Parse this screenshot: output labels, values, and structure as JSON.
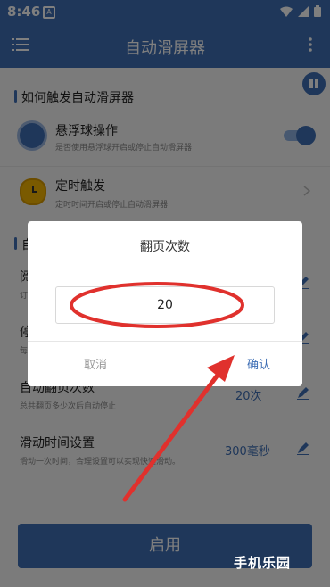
{
  "status_bar": {
    "time": "8:46",
    "sim_label": "A"
  },
  "app_bar": {
    "title": "自动滑屏器"
  },
  "sections": {
    "trigger": {
      "title": "如何触发自动滑屏器",
      "items": [
        {
          "title": "悬浮球操作",
          "subtitle": "是否使用悬浮球开启或停止自动滑屏器",
          "toggle_on": true
        },
        {
          "title": "定时触发",
          "subtitle": "定时时间开启或停止自动滑屏器"
        }
      ]
    },
    "settings": {
      "title_partial": "自",
      "rows": [
        {
          "title": "阅",
          "subtitle": "订"
        },
        {
          "title": "停",
          "subtitle": "每"
        },
        {
          "title": "自动翻页次数",
          "subtitle": "总共翻页多少次后自动停止",
          "value": "20次"
        },
        {
          "title": "滑动时间设置",
          "subtitle": "滑动一次时间，合理设置可以实现快速滑动。",
          "value": "300毫秒"
        }
      ]
    }
  },
  "start_button": {
    "label": "启用"
  },
  "dialog": {
    "title": "翻页次数",
    "input_value": "20",
    "cancel_label": "取消",
    "confirm_label": "确认"
  },
  "watermark": {
    "text": "手机乐园"
  },
  "colors": {
    "primary": "#3f6fb5",
    "annotation": "#e0312d"
  }
}
